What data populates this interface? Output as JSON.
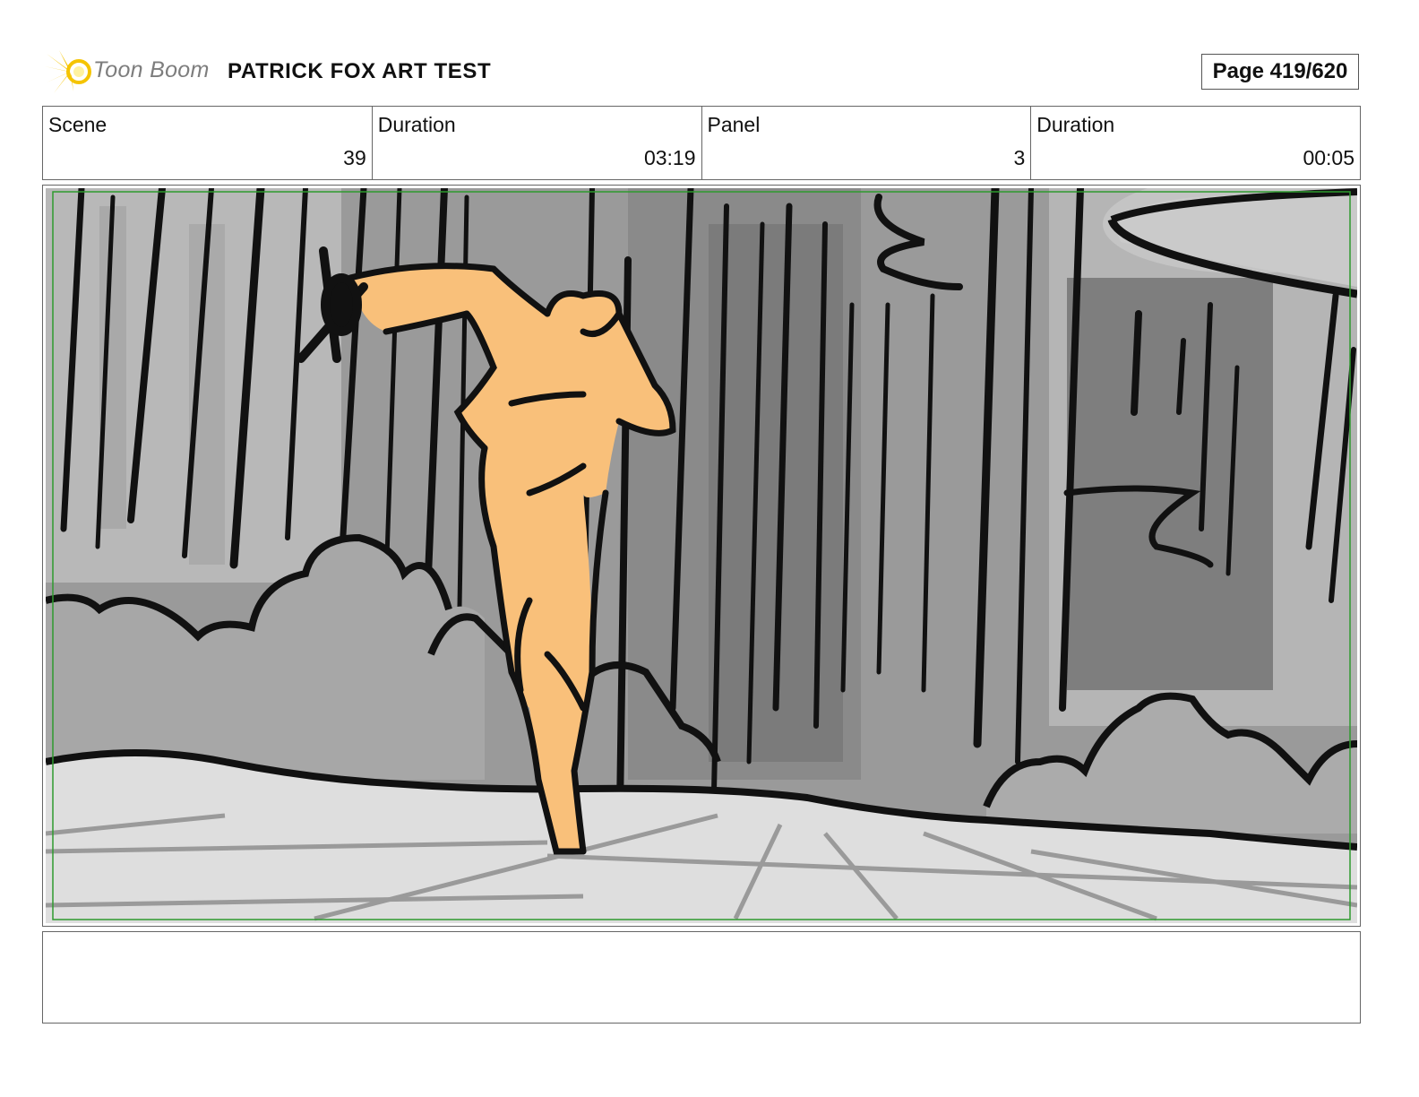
{
  "header": {
    "logo_text": "Toon Boom",
    "title": "PATRICK FOX ART TEST",
    "page": "Page 419/620"
  },
  "info": {
    "scene_label": "Scene",
    "scene_value": "39",
    "scene_duration_label": "Duration",
    "scene_duration_value": "03:19",
    "panel_label": "Panel",
    "panel_value": "3",
    "panel_duration_label": "Duration",
    "panel_duration_value": "00:05"
  },
  "colors": {
    "logo_accent": "#f5c400",
    "figure": "#f9c07a",
    "safe_area": "#2e9a2e"
  },
  "notes": ""
}
